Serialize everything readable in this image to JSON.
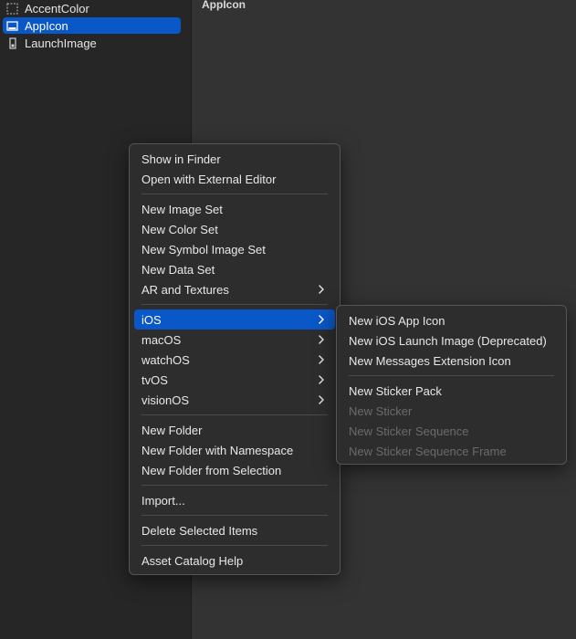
{
  "sidebar": {
    "items": [
      {
        "label": "AccentColor",
        "icon": "color-set-icon",
        "selected": false
      },
      {
        "label": "AppIcon",
        "icon": "app-icon-set-icon",
        "selected": true
      },
      {
        "label": "LaunchImage",
        "icon": "launch-image-icon",
        "selected": false
      }
    ]
  },
  "main": {
    "title": "AppIcon"
  },
  "context_menu": {
    "items": [
      {
        "label": "Show in Finder"
      },
      {
        "label": "Open with External Editor"
      },
      {
        "label": "New Image Set"
      },
      {
        "label": "New Color Set"
      },
      {
        "label": "New Symbol Image Set"
      },
      {
        "label": "New Data Set"
      },
      {
        "label": "AR and Textures",
        "submenu": true
      },
      {
        "label": "iOS",
        "submenu": true,
        "highlighted": true
      },
      {
        "label": "macOS",
        "submenu": true
      },
      {
        "label": "watchOS",
        "submenu": true
      },
      {
        "label": "tvOS",
        "submenu": true
      },
      {
        "label": "visionOS",
        "submenu": true
      },
      {
        "label": "New Folder"
      },
      {
        "label": "New Folder with Namespace"
      },
      {
        "label": "New Folder from Selection"
      },
      {
        "label": "Import..."
      },
      {
        "label": "Delete Selected Items"
      },
      {
        "label": "Asset Catalog Help"
      }
    ]
  },
  "submenu_ios": {
    "items": [
      {
        "label": "New iOS App Icon",
        "enabled": true
      },
      {
        "label": "New iOS Launch Image (Deprecated)",
        "enabled": true
      },
      {
        "label": "New Messages Extension Icon",
        "enabled": true
      },
      {
        "label": "New Sticker Pack",
        "enabled": true
      },
      {
        "label": "New Sticker",
        "enabled": false
      },
      {
        "label": "New Sticker Sequence",
        "enabled": false
      },
      {
        "label": "New Sticker Sequence Frame",
        "enabled": false
      }
    ]
  },
  "colors": {
    "selection": "#0a57c8",
    "menu_background": "#2d2d2d",
    "sidebar_background": "#262626",
    "main_background": "#333333",
    "disabled_text": "#6b6b6b"
  }
}
